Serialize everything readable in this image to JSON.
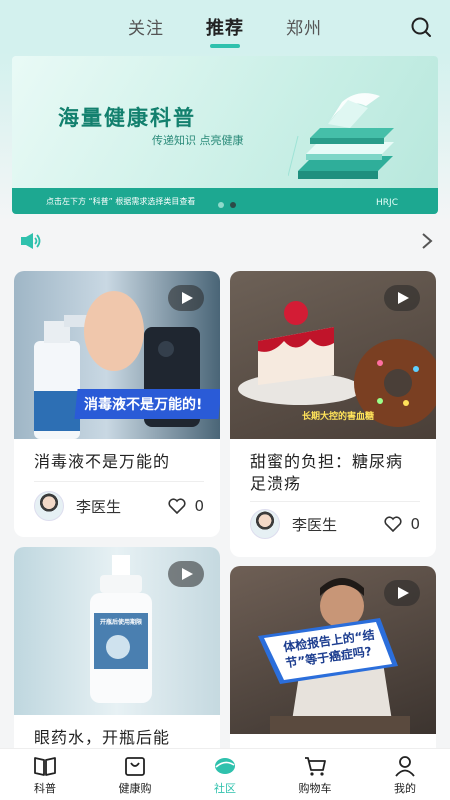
{
  "header": {
    "tabs": [
      {
        "label": "关注"
      },
      {
        "label": "推荐"
      },
      {
        "label": "郑州"
      }
    ],
    "active_tab": "推荐",
    "search_icon": "search-icon"
  },
  "banner": {
    "title": "海量健康科普",
    "subtitle": "传递知识 点亮健康",
    "strip_text": "点击左下方 “科普” 根据需求选择类目查看",
    "logo": "HRJC",
    "slide_count": 2,
    "active_slide": 2
  },
  "notice": {
    "icon": "speaker-icon",
    "more_icon": "chevron-right-icon"
  },
  "cards": [
    {
      "title": "消毒液不是万能的",
      "overlay": "消毒液不是万能的!",
      "author": "李医生",
      "likes": "0"
    },
    {
      "title": "甜蜜的负担：糖尿病足溃疡",
      "overlay": "长期大控的害血糖",
      "author": "李医生",
      "likes": "0"
    },
    {
      "title": "眼药水，开瓶后能",
      "overlay": "开瓶后使用期限",
      "author": "",
      "likes": ""
    },
    {
      "title": "",
      "overlay": "体检报告上的“结节”等于癌症吗?",
      "author": "",
      "likes": ""
    }
  ],
  "bottom_nav": [
    {
      "label": "科普",
      "icon": "book-icon"
    },
    {
      "label": "健康购",
      "icon": "shopping-bag-icon"
    },
    {
      "label": "社区",
      "icon": "community-icon"
    },
    {
      "label": "购物车",
      "icon": "cart-icon"
    },
    {
      "label": "我的",
      "icon": "user-icon"
    }
  ],
  "colors": {
    "accent": "#2fc1ad",
    "header_bg": "#d3f1ee",
    "banner_title": "#13806e",
    "overlay_blue": "#2a5bd7"
  }
}
